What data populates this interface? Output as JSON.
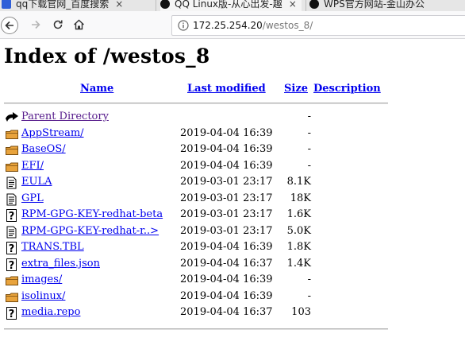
{
  "browser": {
    "tabs": [
      {
        "label": "qq下载官网_百度搜索",
        "close": "×"
      },
      {
        "label": "QQ Linux版-从心出发-趣",
        "close": "×"
      },
      {
        "label": "WPS官方网站-金山办公"
      }
    ],
    "url": {
      "host": "172.25.254.20",
      "path": "/westos_8/"
    }
  },
  "page": {
    "title": "Index of /westos_8",
    "headers": {
      "name": "Name",
      "modified": "Last modified",
      "size": "Size",
      "description": "Description"
    },
    "entries": [
      {
        "icon": "back-icon",
        "name": "Parent Directory",
        "modified": "",
        "size": "-"
      },
      {
        "icon": "folder-icon",
        "name": "AppStream/",
        "modified": "2019-04-04 16:39",
        "size": "-"
      },
      {
        "icon": "folder-icon",
        "name": "BaseOS/",
        "modified": "2019-04-04 16:39",
        "size": "-"
      },
      {
        "icon": "folder-icon",
        "name": "EFI/",
        "modified": "2019-04-04 16:39",
        "size": "-"
      },
      {
        "icon": "text-icon",
        "name": "EULA",
        "modified": "2019-03-01 23:17",
        "size": "8.1K"
      },
      {
        "icon": "text-icon",
        "name": "GPL",
        "modified": "2019-03-01 23:17",
        "size": "18K"
      },
      {
        "icon": "unknown-icon",
        "name": "RPM-GPG-KEY-redhat-beta",
        "modified": "2019-03-01 23:17",
        "size": "1.6K"
      },
      {
        "icon": "text-icon",
        "name": "RPM-GPG-KEY-redhat-r..>",
        "modified": "2019-03-01 23:17",
        "size": "5.0K"
      },
      {
        "icon": "unknown-icon",
        "name": "TRANS.TBL",
        "modified": "2019-04-04 16:39",
        "size": "1.8K"
      },
      {
        "icon": "unknown-icon",
        "name": "extra_files.json",
        "modified": "2019-04-04 16:37",
        "size": "1.4K"
      },
      {
        "icon": "folder-icon",
        "name": "images/",
        "modified": "2019-04-04 16:39",
        "size": "-"
      },
      {
        "icon": "folder-icon",
        "name": "isolinux/",
        "modified": "2019-04-04 16:39",
        "size": "-"
      },
      {
        "icon": "unknown-icon",
        "name": "media.repo",
        "modified": "2019-04-04 16:37",
        "size": "103"
      }
    ]
  }
}
